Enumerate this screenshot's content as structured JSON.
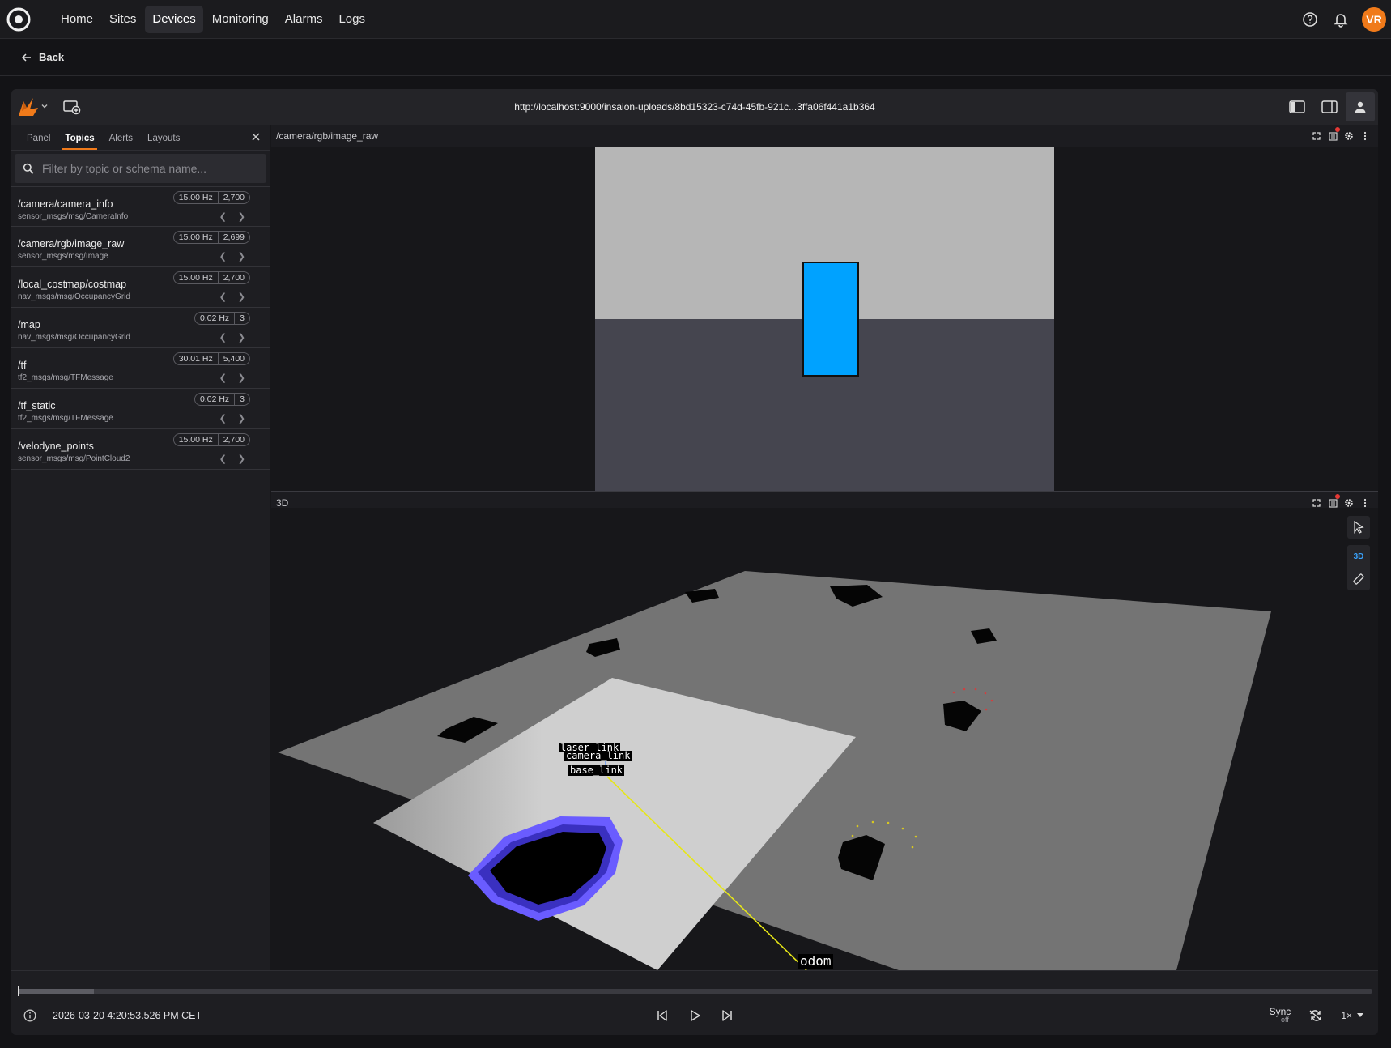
{
  "nav": {
    "items": [
      {
        "label": "Home",
        "active": false
      },
      {
        "label": "Sites",
        "active": false
      },
      {
        "label": "Devices",
        "active": true
      },
      {
        "label": "Monitoring",
        "active": false
      },
      {
        "label": "Alarms",
        "active": false
      },
      {
        "label": "Logs",
        "active": false
      }
    ],
    "avatar": "VR"
  },
  "back": {
    "label": "Back"
  },
  "app": {
    "url": "http://localhost:9000/insaion-uploads/8bd15323-c74d-45fb-921c...3ffa06f441a1b364"
  },
  "sidebar": {
    "tabs": [
      "Panel",
      "Topics",
      "Alerts",
      "Layouts"
    ],
    "active_tab": "Topics",
    "search_placeholder": "Filter by topic or schema name...",
    "topics": [
      {
        "name": "/camera/camera_info",
        "schema": "sensor_msgs/msg/CameraInfo",
        "hz": "15.00 Hz",
        "count": "2,700"
      },
      {
        "name": "/camera/rgb/image_raw",
        "schema": "sensor_msgs/msg/Image",
        "hz": "15.00 Hz",
        "count": "2,699"
      },
      {
        "name": "/local_costmap/costmap",
        "schema": "nav_msgs/msg/OccupancyGrid",
        "hz": "15.00 Hz",
        "count": "2,700"
      },
      {
        "name": "/map",
        "schema": "nav_msgs/msg/OccupancyGrid",
        "hz": "0.02 Hz",
        "count": "3"
      },
      {
        "name": "/tf",
        "schema": "tf2_msgs/msg/TFMessage",
        "hz": "30.01 Hz",
        "count": "5,400"
      },
      {
        "name": "/tf_static",
        "schema": "tf2_msgs/msg/TFMessage",
        "hz": "0.02 Hz",
        "count": "3"
      },
      {
        "name": "/velodyne_points",
        "schema": "sensor_msgs/msg/PointCloud2",
        "hz": "15.00 Hz",
        "count": "2,700"
      }
    ]
  },
  "image_panel": {
    "title": "/camera/rgb/image_raw"
  },
  "panel_3d": {
    "title": "3D",
    "tool_3d_label": "3D",
    "frame_labels": {
      "laser": "laser_link",
      "camera": "camera_link",
      "base": "base_link",
      "odom": "odom"
    }
  },
  "playback": {
    "timestamp": "2026-03-20 4:20:53.526 PM CET",
    "progress": 0.056,
    "sync_label": "Sync",
    "sync_state": "off",
    "speed": "1×"
  },
  "colors": {
    "accent": "#f07a1a",
    "costmap": "#6a5cff",
    "camera_object": "#00a2ff",
    "tf_line": "#e6e617"
  }
}
